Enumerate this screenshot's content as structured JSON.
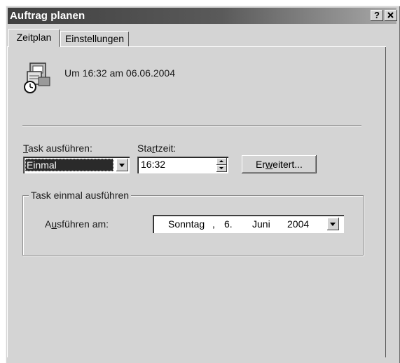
{
  "window": {
    "title": "Auftrag planen",
    "help_button": "?",
    "close_button": "x"
  },
  "tabs": [
    {
      "label": "Zeitplan",
      "active": true
    },
    {
      "label": "Einstellungen",
      "active": false
    }
  ],
  "summary": {
    "icon": "scheduled-task-icon",
    "text": "Um 16:32 am 06.06.2004"
  },
  "schedule": {
    "run_task_label_mnemonic": "T",
    "run_task_label_rest": "ask ausführen:",
    "run_task_value": "Einmal",
    "start_time_label_pre": "Sta",
    "start_time_label_mnemonic": "r",
    "start_time_label_post": "tzeit:",
    "start_time_value": "16:32",
    "advanced_button_pre": "Er",
    "advanced_button_mnemonic": "w",
    "advanced_button_post": "eitert..."
  },
  "once_group": {
    "title": "Task einmal ausführen",
    "run_on_label_pre": "A",
    "run_on_label_mnemonic": "u",
    "run_on_label_post": "sführen am:",
    "date": {
      "weekday": "Sonntag",
      "sep": ",",
      "day": "6.",
      "month": "Juni",
      "year": "2004"
    }
  },
  "colors": {
    "titlebar_start": "#3f3f3f",
    "titlebar_end": "#a9a9a9",
    "dialog_bg": "#d4d4d4",
    "selection_bg": "#2a2a2a"
  }
}
